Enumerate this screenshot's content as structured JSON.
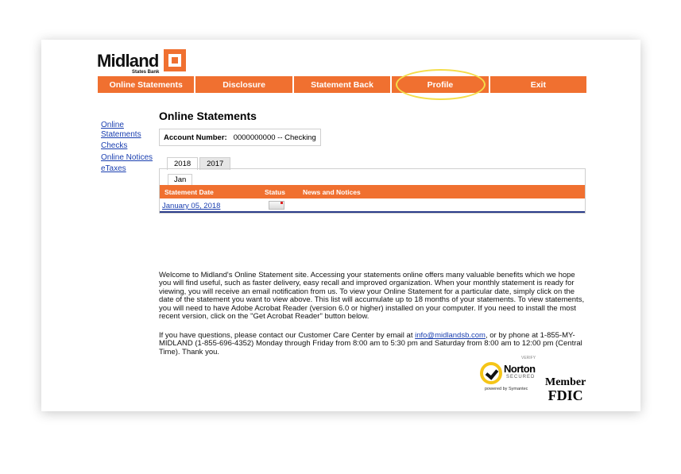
{
  "logo": {
    "brand": "Midland",
    "sub": "States Bank"
  },
  "nav": [
    "Online Statements",
    "Disclosure",
    "Statement Back",
    "Profile",
    "Exit"
  ],
  "sidebar": [
    "Online Statements",
    "Checks",
    "Online Notices",
    "eTaxes"
  ],
  "main": {
    "title": "Online Statements",
    "account_label": "Account Number:",
    "account_value": "0000000000 -- Checking",
    "year_tabs": [
      "2018",
      "2017"
    ],
    "month_tab": "Jan",
    "columns": [
      "Statement Date",
      "Status",
      "News and Notices"
    ],
    "rows": [
      {
        "date": "January 05, 2018"
      }
    ],
    "para1": "Welcome to Midland's Online Statement site. Accessing your statements online offers many valuable benefits which we hope you will find useful, such as faster delivery, easy recall and improved organization. When your monthly statement is ready for viewing, you will receive an email notification from us. To view your Online Statement for a particular date, simply click on the date of the statement you want to view above. This list will accumulate up to 18 months of your statements. To view statements, you will need to have Adobe Acrobat Reader (version 6.0 or higher) installed on your computer. If you need to install the most recent version, click on the \"Get Acrobat Reader\" button below.",
    "para2_pre": "If you have questions, please contact our Customer Care Center by email at ",
    "para2_email": "info@midlandsb.com",
    "para2_post": ", or by phone at 1-855-MY-MIDLAND (1-855-696-4352) Monday through Friday from 8:00 am to 5:30 pm and Saturday from 8:00 am to 12:00 pm (Central Time). Thank you."
  },
  "badges": {
    "verify": "VERIFY",
    "norton": "Norton",
    "secured": "SECURED",
    "powered": "powered by Symantec",
    "member": "Member",
    "fdic": "FDIC"
  }
}
